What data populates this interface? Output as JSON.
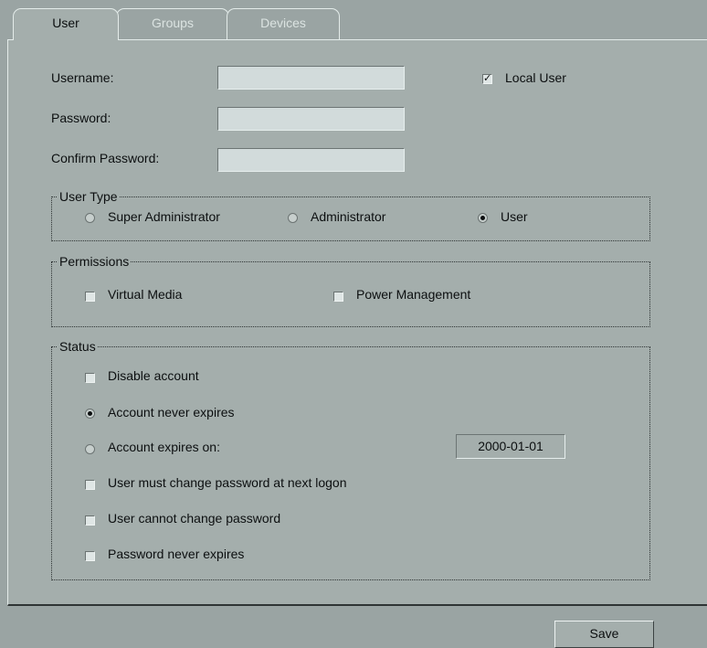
{
  "tabs": [
    {
      "label": "User"
    },
    {
      "label": "Groups"
    },
    {
      "label": "Devices"
    }
  ],
  "form": {
    "username_label": "Username:",
    "username_value": "",
    "password_label": "Password:",
    "password_value": "",
    "confirm_label": "Confirm Password:",
    "confirm_value": "",
    "local_user_label": "Local User",
    "local_user_checked": true
  },
  "user_type": {
    "title": "User Type",
    "options": [
      {
        "label": "Super Administrator",
        "selected": false
      },
      {
        "label": "Administrator",
        "selected": false
      },
      {
        "label": "User",
        "selected": true
      }
    ]
  },
  "permissions": {
    "title": "Permissions",
    "items": [
      {
        "label": "Virtual Media",
        "checked": false
      },
      {
        "label": "Power Management",
        "checked": false
      }
    ]
  },
  "status": {
    "title": "Status",
    "disable_account": "Disable account",
    "never_expires": "Account never expires",
    "expires_on": "Account expires on:",
    "expiry_date": "2000-01-01",
    "must_change": "User must change password at next logon",
    "cannot_change": "User cannot change password",
    "password_never_expires": "Password never expires"
  },
  "footer": {
    "save_label": "Save"
  },
  "colors": {
    "background": "#9aa4a3",
    "panel": "#a4aeac",
    "input": "#d2dbdb"
  }
}
